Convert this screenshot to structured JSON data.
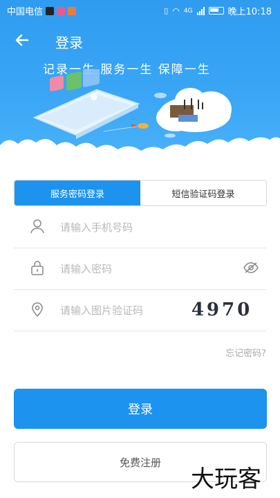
{
  "status_bar": {
    "carrier": "中国电信",
    "network": "4G",
    "time_label": "晚上10:18"
  },
  "header": {
    "title": "登录",
    "slogan": "记录一生 服务一生 保障一生"
  },
  "tabs": [
    {
      "label": "服务密码登录",
      "active": true
    },
    {
      "label": "短信验证码登录",
      "active": false
    }
  ],
  "form": {
    "phone_placeholder": "请输入手机号码",
    "password_placeholder": "请输入密码",
    "captcha_placeholder": "请输入图片验证码",
    "captcha_code": "4970"
  },
  "forgot_label": "忘记密码?",
  "login_label": "登录",
  "register_label": "免费注册",
  "watermark": "大玩客",
  "colors": {
    "primary": "#1c93ee",
    "header": "#2f9cf0"
  }
}
